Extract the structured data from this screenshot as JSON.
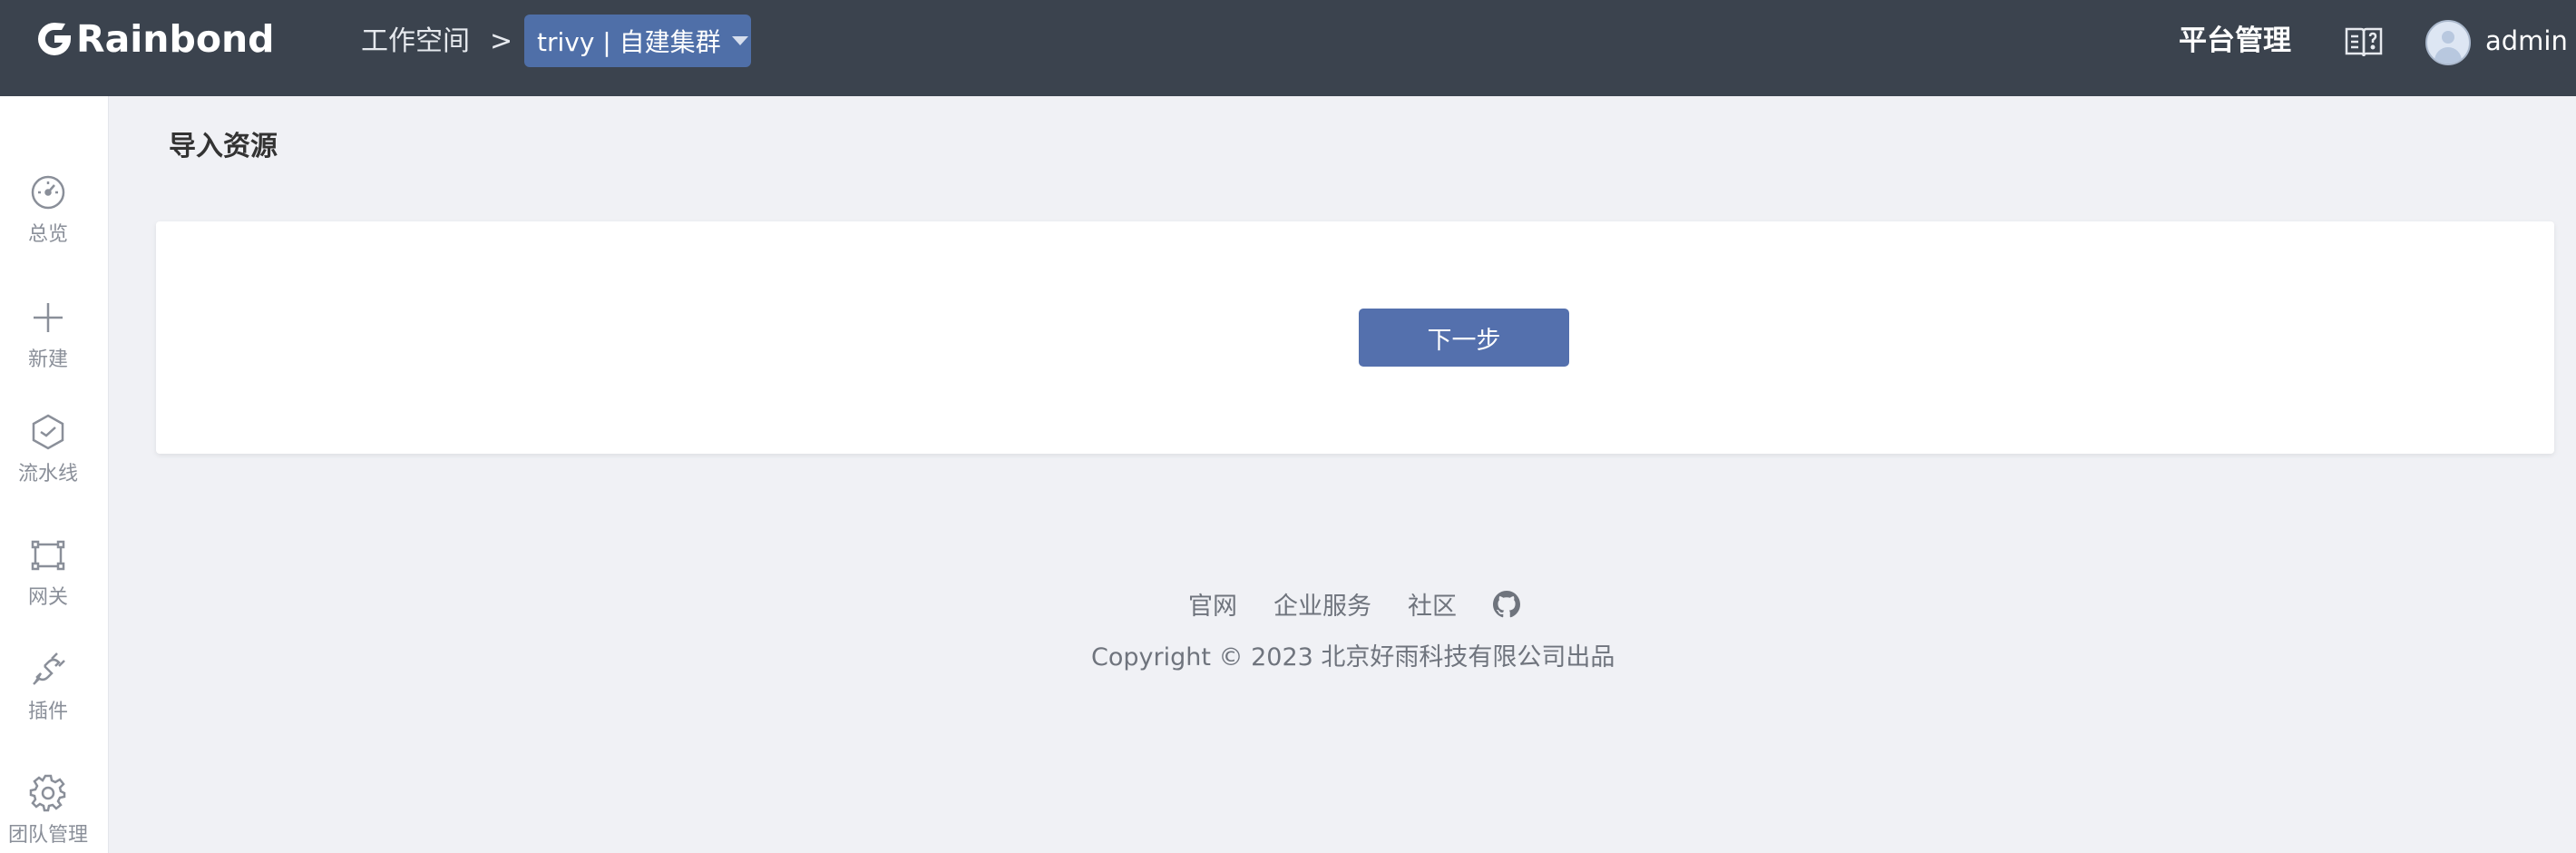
{
  "header": {
    "logo_text": "Rainbond",
    "breadcrumb_workspace": "工作空间",
    "breadcrumb_separator": ">",
    "workspace_select": "trivy | 自建集群",
    "platform_admin": "平台管理",
    "username": "admin",
    "bg_color": "#3b434e",
    "accent_color": "#4f6fa8"
  },
  "sidebar": {
    "items": [
      {
        "label": "总览",
        "icon": "dashboard-gauge-icon"
      },
      {
        "label": "新建",
        "icon": "plus-icon"
      },
      {
        "label": "流水线",
        "icon": "pipeline-cube-icon"
      },
      {
        "label": "网关",
        "icon": "gateway-icon"
      },
      {
        "label": "插件",
        "icon": "plug-icon"
      },
      {
        "label": "团队管理",
        "icon": "gear-icon"
      }
    ]
  },
  "main": {
    "page_title": "导入资源",
    "next_button": "下一步"
  },
  "footer": {
    "links": [
      "官网",
      "企业服务",
      "社区"
    ],
    "github_icon": "github-icon",
    "copyright": "Copyright © 2023 北京好雨科技有限公司出品"
  }
}
